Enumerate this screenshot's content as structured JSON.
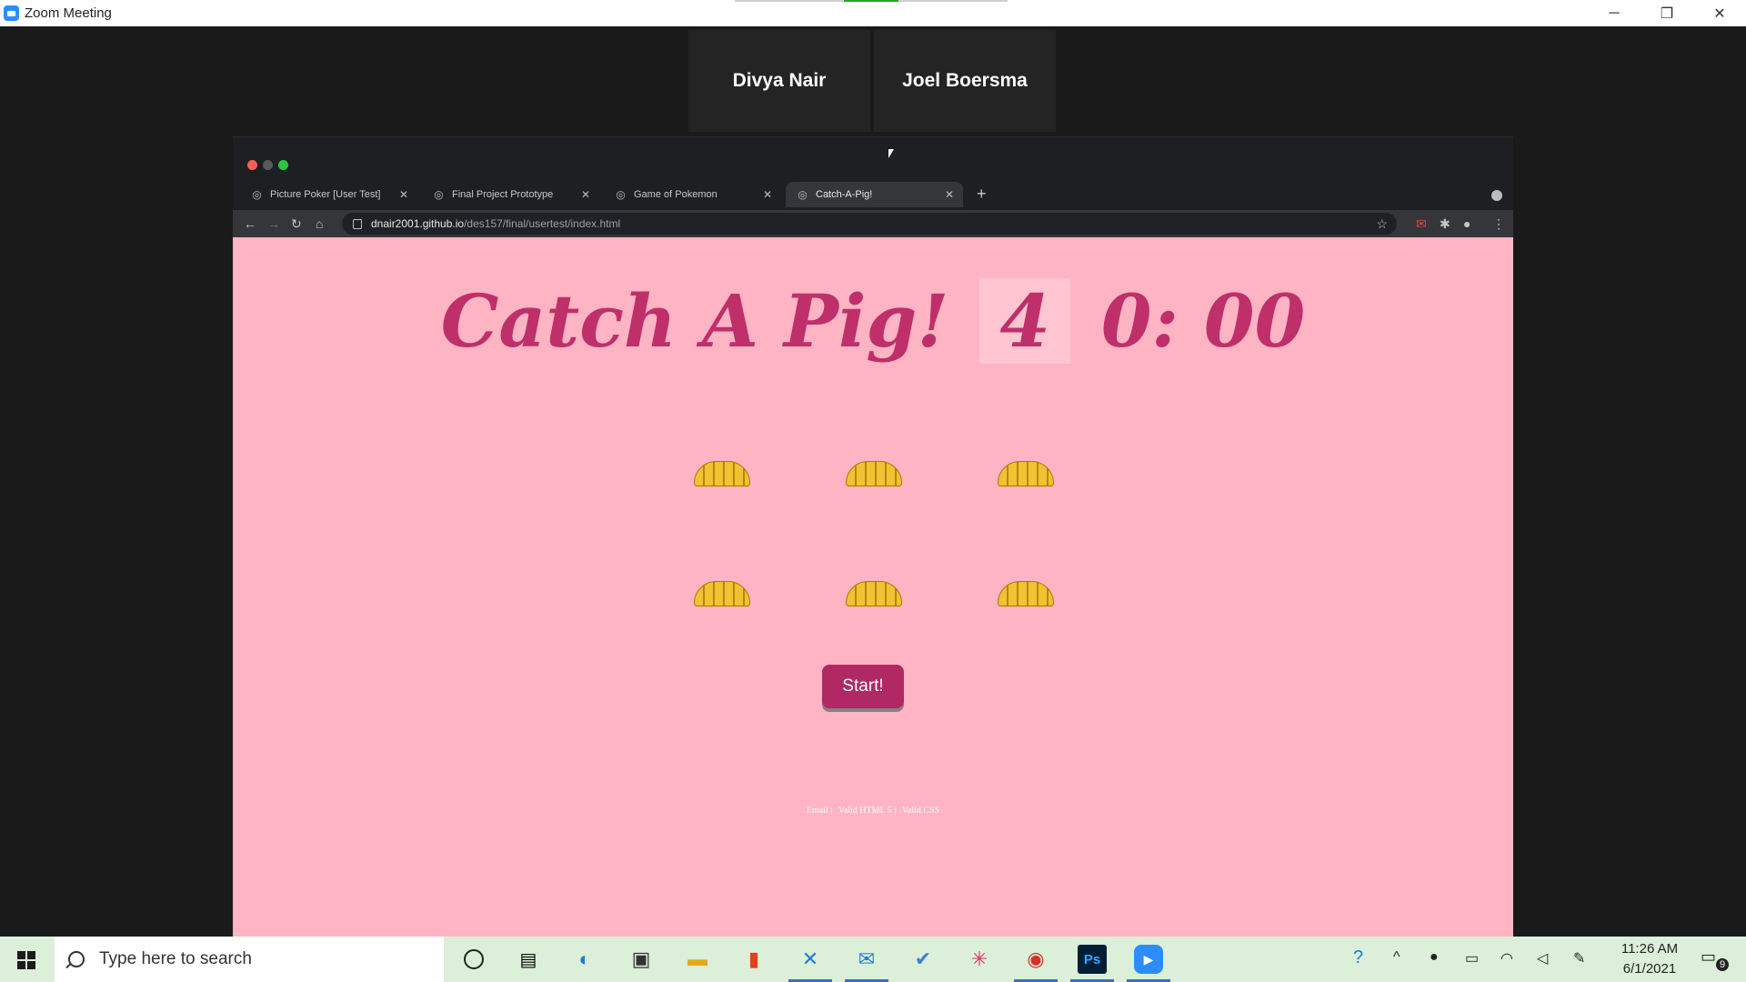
{
  "zoom": {
    "title": "Zoom Meeting",
    "window_controls": {
      "minimize": "─",
      "restore": "❐",
      "close": "✕"
    }
  },
  "participants": [
    {
      "name": "Divya Nair"
    },
    {
      "name": "Joel Boersma"
    }
  ],
  "browser": {
    "tabs": [
      {
        "title": "Picture Poker [User Test]",
        "active": false
      },
      {
        "title": "Final Project Prototype",
        "active": false
      },
      {
        "title": "Game of Pokemon",
        "active": false
      },
      {
        "title": "Catch-A-Pig!",
        "active": true
      }
    ],
    "new_tab_glyph": "+",
    "url_host": "dnair2001.github.io",
    "url_path": "/des157/final/usertest/index.html",
    "nav": {
      "back": "←",
      "forward": "→",
      "reload": "↻",
      "home": "⌂"
    }
  },
  "game": {
    "title": "Catch A Pig!",
    "countdown": "4",
    "timer": "0: 00",
    "burrow_count": 6,
    "start_label": "Start!",
    "footer_links": [
      "Email |",
      "Valid HTML 5 |",
      "Valid CSS"
    ]
  },
  "taskbar": {
    "search_placeholder": "Type here to search",
    "time": "11:26 AM",
    "date": "6/1/2021",
    "notification_count": "9"
  },
  "colors": {
    "page_background": "#ffb4c3",
    "title_color": "#bf2f6a",
    "start_button": "#b02964",
    "taskbar": "#dcefd9"
  }
}
